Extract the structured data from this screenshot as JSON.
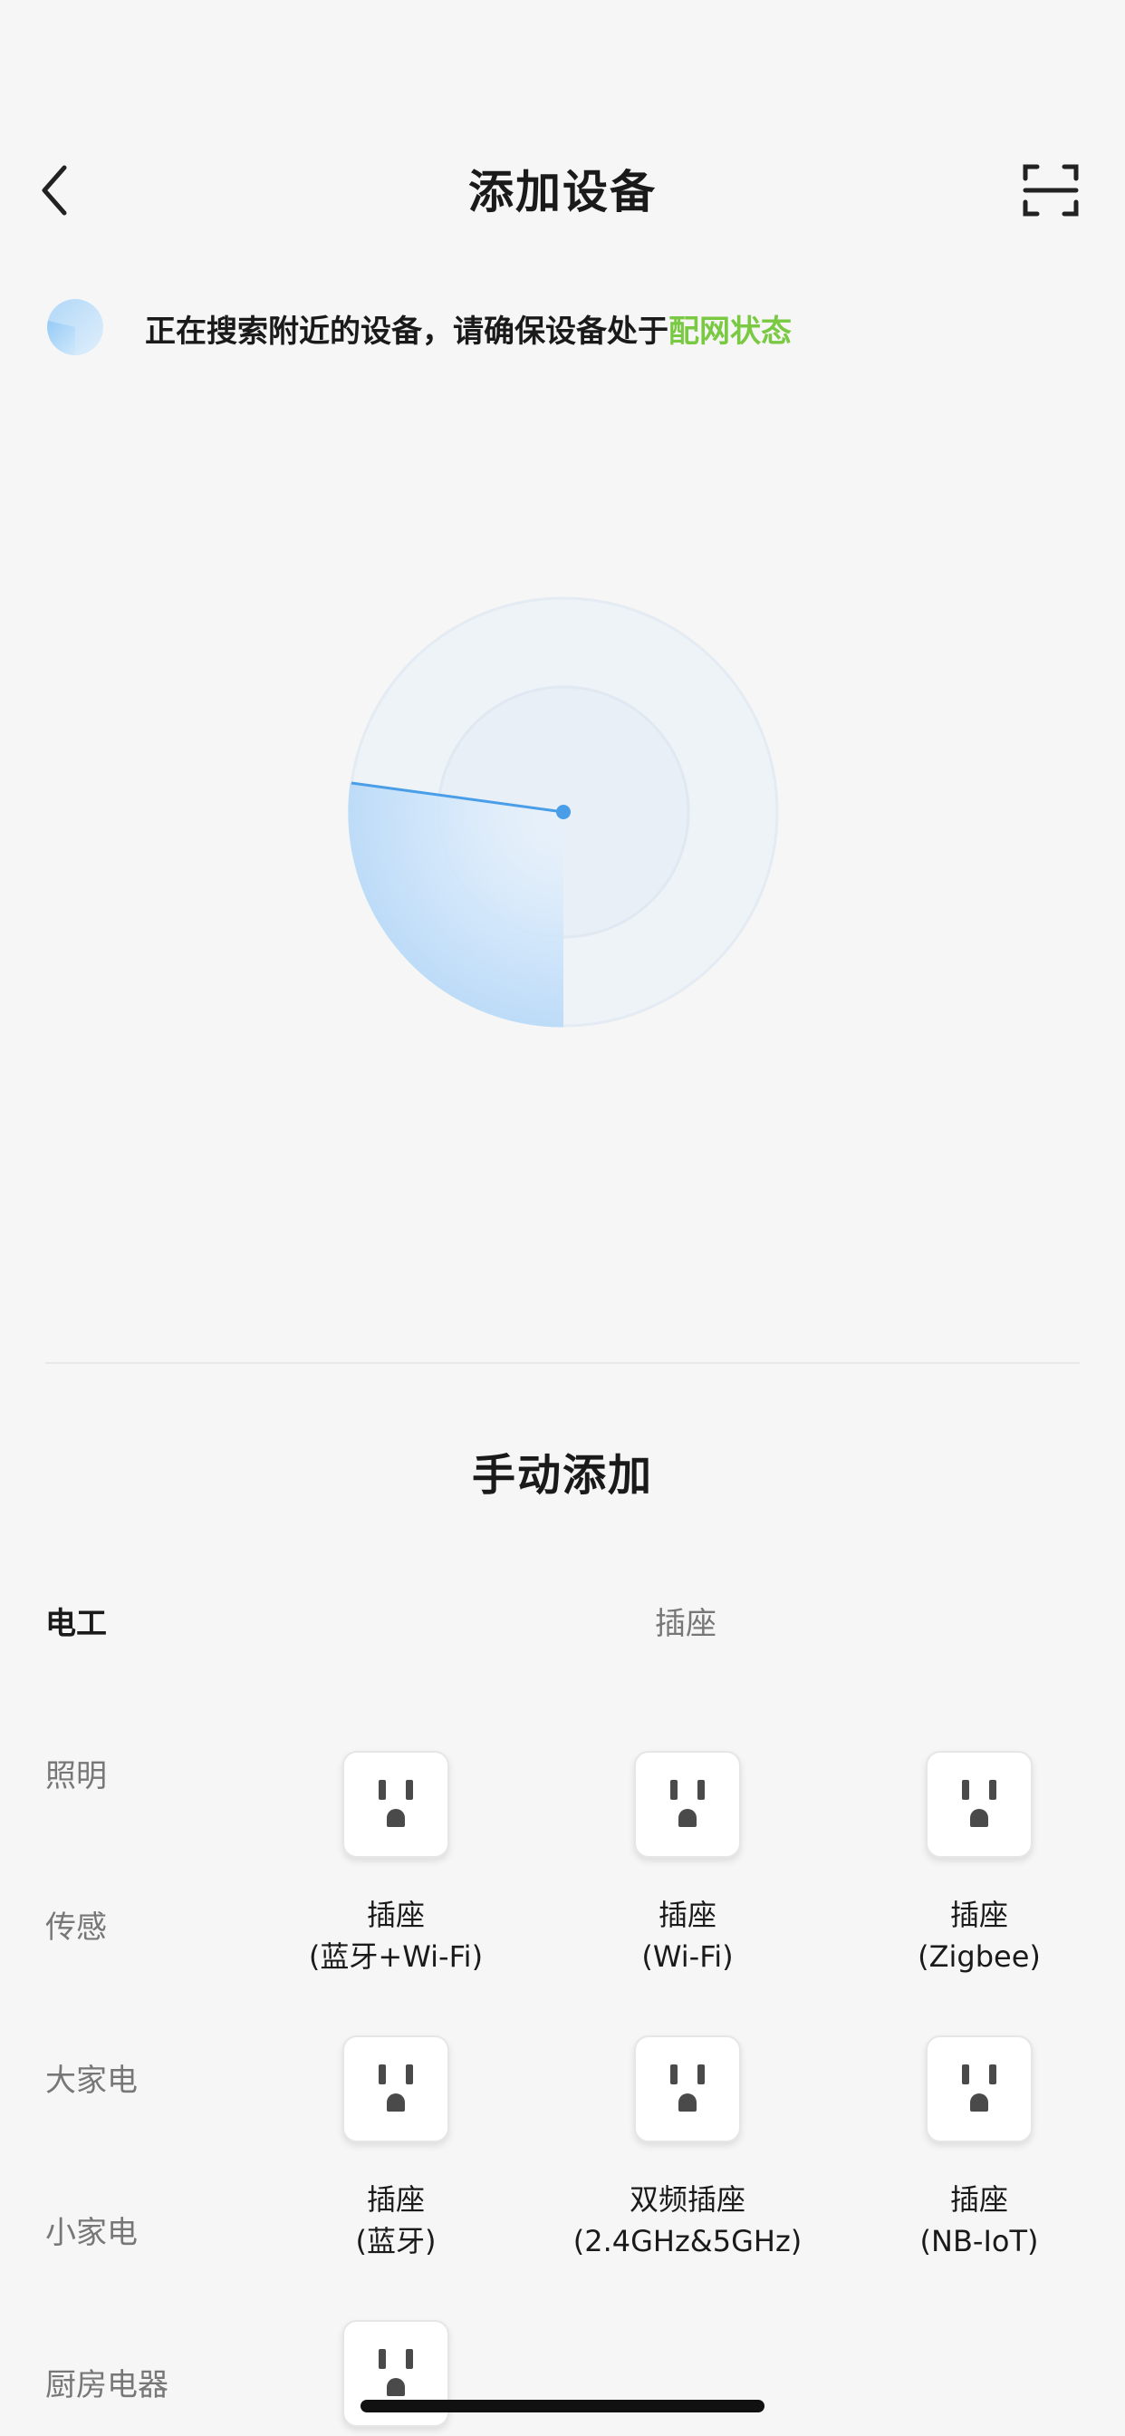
{
  "header": {
    "title": "添加设备"
  },
  "status": {
    "text": "正在搜索附近的设备，请确保设备处于",
    "link": "配网状态"
  },
  "manual": {
    "title": "手动添加"
  },
  "categories": [
    {
      "label": "电工",
      "active": true
    },
    {
      "label": "照明",
      "active": false
    },
    {
      "label": "传感",
      "active": false
    },
    {
      "label": "大家电",
      "active": false
    },
    {
      "label": "小家电",
      "active": false
    },
    {
      "label": "厨房电器",
      "active": false
    }
  ],
  "section": {
    "label": "插座"
  },
  "devices": [
    {
      "line1": "插座",
      "line2": "(蓝牙+Wi-Fi)",
      "icon": "power-socket-icon"
    },
    {
      "line1": "插座",
      "line2": "(Wi-Fi)",
      "icon": "power-socket-icon"
    },
    {
      "line1": "插座",
      "line2": "(Zigbee)",
      "icon": "power-socket-icon"
    },
    {
      "line1": "插座",
      "line2": "(蓝牙)",
      "icon": "power-socket-icon"
    },
    {
      "line1": "双频插座",
      "line2": "(2.4GHz&5GHz)",
      "icon": "power-socket-icon"
    },
    {
      "line1": "插座",
      "line2": "(NB-IoT)",
      "icon": "power-socket-icon"
    },
    {
      "line1": "",
      "line2": "",
      "icon": "power-socket-icon"
    }
  ],
  "colors": {
    "accent_green": "#7ac943",
    "radar_blue": "#4a9ee8"
  }
}
